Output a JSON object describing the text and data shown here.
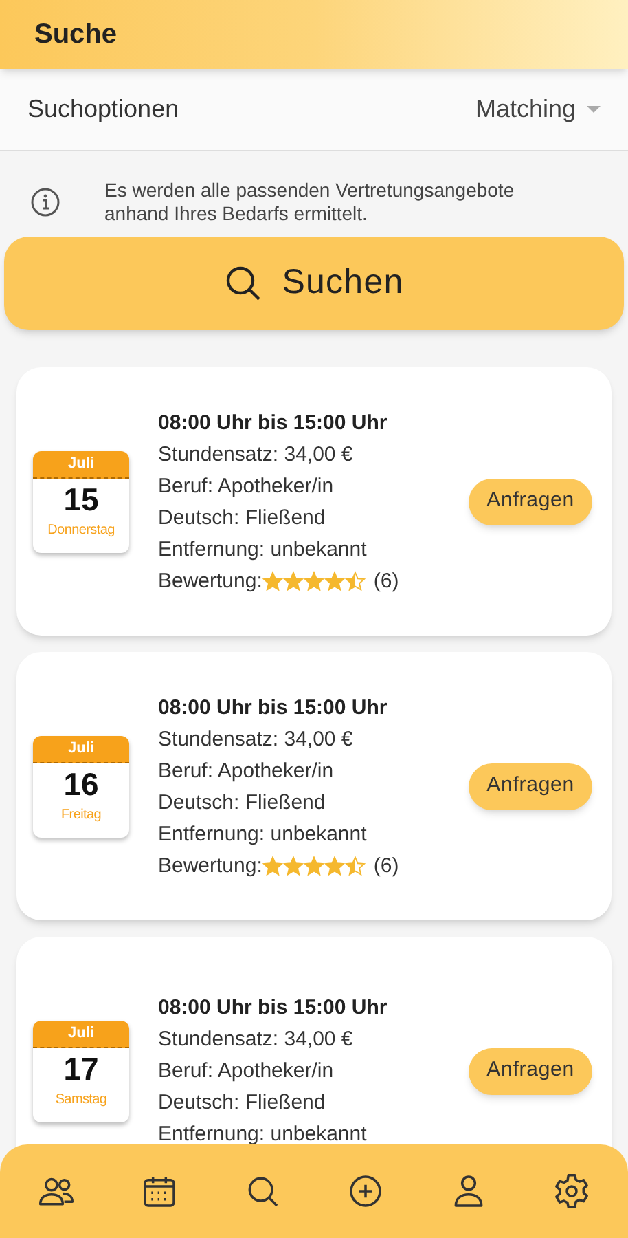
{
  "header": {
    "title": "Suche"
  },
  "search_options": {
    "label": "Suchoptionen",
    "value": "Matching"
  },
  "info": "Es werden alle passenden Vertretungsangebote anhand Ihres Bedarfs ermittelt.",
  "search_button": "Suchen",
  "offers": [
    {
      "month": "Juli",
      "day": "15",
      "weekday": "Donnerstag",
      "time": "08:00 Uhr bis 15:00 Uhr",
      "lines": [
        "Stundensatz: 34,00 €",
        "Beruf: Apotheker/in",
        "Deutsch: Fließend",
        "Entfernung: unbekannt"
      ],
      "rating_label": "Bewertung:",
      "stars": 4.5,
      "rating_count": "(6)",
      "button": "Anfragen"
    },
    {
      "month": "Juli",
      "day": "16",
      "weekday": "Freitag",
      "time": "08:00 Uhr bis 15:00 Uhr",
      "lines": [
        "Stundensatz: 34,00 €",
        "Beruf: Apotheker/in",
        "Deutsch: Fließend",
        "Entfernung: unbekannt"
      ],
      "rating_label": "Bewertung:",
      "stars": 4.5,
      "rating_count": "(6)",
      "button": "Anfragen"
    },
    {
      "month": "Juli",
      "day": "17",
      "weekday": "Samstag",
      "time": "08:00 Uhr bis 15:00 Uhr",
      "lines": [
        "Stundensatz: 34,00 €",
        "Beruf: Apotheker/in",
        "Deutsch: Fließend",
        "Entfernung: unbekannt"
      ],
      "button": "Anfragen"
    }
  ],
  "nav": [
    {
      "kind": "people"
    },
    {
      "kind": "calendar"
    },
    {
      "kind": "search"
    },
    {
      "kind": "add"
    },
    {
      "kind": "person"
    },
    {
      "kind": "settings"
    }
  ]
}
